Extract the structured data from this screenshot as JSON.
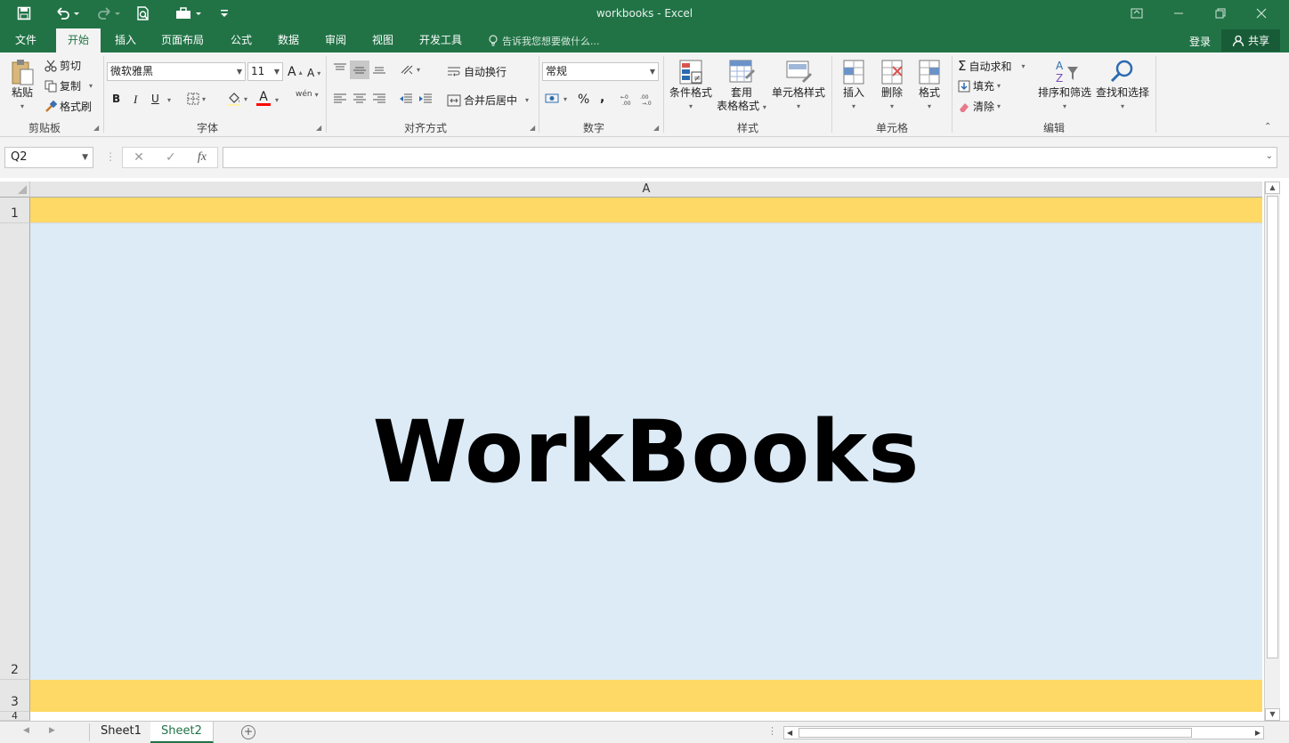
{
  "window": {
    "title": "workbooks - Excel",
    "quick_access": [
      "save-icon",
      "undo-icon",
      "redo-icon",
      "print-preview-icon",
      "touch-mode-icon",
      "customize-qat-icon"
    ]
  },
  "tabs": [
    {
      "label": "文件"
    },
    {
      "label": "开始",
      "active": true
    },
    {
      "label": "插入"
    },
    {
      "label": "页面布局"
    },
    {
      "label": "公式"
    },
    {
      "label": "数据"
    },
    {
      "label": "审阅"
    },
    {
      "label": "视图"
    },
    {
      "label": "开发工具"
    }
  ],
  "tell_me": "告诉我您想要做什么...",
  "account": {
    "login": "登录",
    "share": "共享"
  },
  "ribbon": {
    "clipboard": {
      "paste": "粘贴",
      "cut": "剪切",
      "copy": "复制",
      "format_painter": "格式刷",
      "label": "剪贴板"
    },
    "font": {
      "name": "微软雅黑",
      "size": "11",
      "bold": "B",
      "italic": "I",
      "underline": "U",
      "label": "字体",
      "grow": "A",
      "shrink": "A",
      "font_color_letter": "A",
      "wen": "wén"
    },
    "alignment": {
      "wrap": "自动换行",
      "merge": "合并后居中",
      "label": "对齐方式"
    },
    "number": {
      "format": "常规",
      "percent": "%",
      "comma": ",",
      "label": "数字"
    },
    "styles": {
      "conditional": "条件格式",
      "table1": "套用",
      "table2": "表格格式",
      "cell_styles": "单元格样式",
      "label": "样式"
    },
    "cells": {
      "insert": "插入",
      "delete": "删除",
      "format": "格式",
      "label": "单元格"
    },
    "editing": {
      "autosum": "自动求和",
      "fill": "填充",
      "clear": "清除",
      "sort": "排序和筛选",
      "find": "查找和选择",
      "label": "编辑"
    }
  },
  "formula_bar": {
    "name_box": "Q2",
    "fx": "fx",
    "value": ""
  },
  "sheet": {
    "column_header": "A",
    "rows": [
      {
        "num": "1",
        "text": ""
      },
      {
        "num": "2",
        "text": "WorkBooks"
      },
      {
        "num": "3",
        "text": ""
      },
      {
        "num": "4",
        "text": ""
      }
    ]
  },
  "sheet_tabs": [
    {
      "label": "Sheet1",
      "active": false
    },
    {
      "label": "Sheet2",
      "active": true
    }
  ],
  "colors": {
    "brand": "#217346",
    "row_highlight": "#ffd966",
    "cell_fill": "#ddebf7"
  }
}
